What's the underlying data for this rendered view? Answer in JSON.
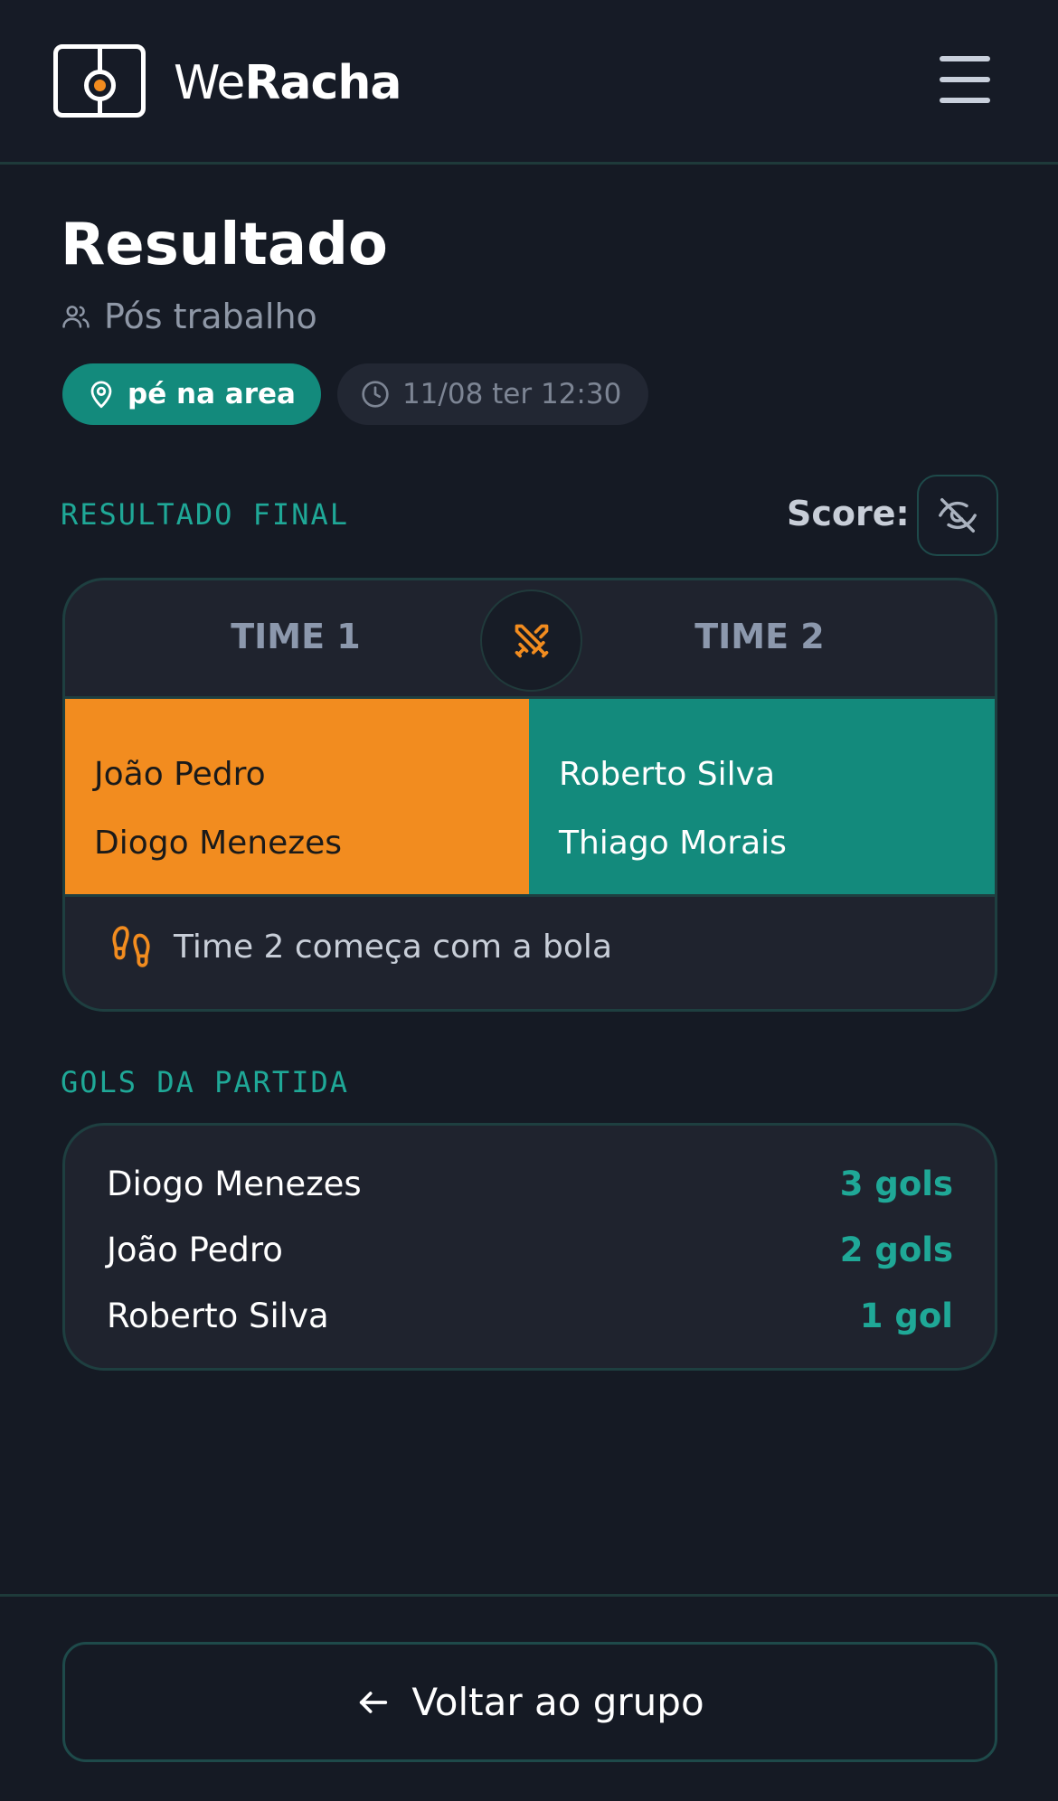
{
  "header": {
    "brand_light": "We",
    "brand_bold": "Racha",
    "logo_icon": "soccer-field-icon",
    "menu_icon": "hamburger-menu-icon"
  },
  "page": {
    "title": "Resultado",
    "group_name": "Pós trabalho",
    "location": "pé na area",
    "datetime": "11/08 ter 12:30"
  },
  "result": {
    "section_label": "RESULTADO FINAL",
    "score_label": "Score:",
    "score_toggle_icon": "eye-off-icon",
    "vs_icon": "crossed-swords-icon",
    "team1": {
      "name": "TIME 1",
      "players": [
        "João Pedro",
        "Diogo Menezes"
      ]
    },
    "team2": {
      "name": "TIME 2",
      "players": [
        "Roberto Silva",
        "Thiago Morais"
      ]
    },
    "kickoff_text": "Time 2 começa com a bola",
    "colors": {
      "team1": "#f28c1f",
      "team2": "#138a7c",
      "accent": "#1fa897"
    }
  },
  "goals": {
    "section_label": "GOLS DA PARTIDA",
    "rows": [
      {
        "name": "Diogo Menezes",
        "count": "3 gols"
      },
      {
        "name": "João Pedro",
        "count": "2 gols"
      },
      {
        "name": "Roberto Silva",
        "count": "1 gol"
      }
    ]
  },
  "footer": {
    "back_label": "Voltar ao grupo"
  }
}
